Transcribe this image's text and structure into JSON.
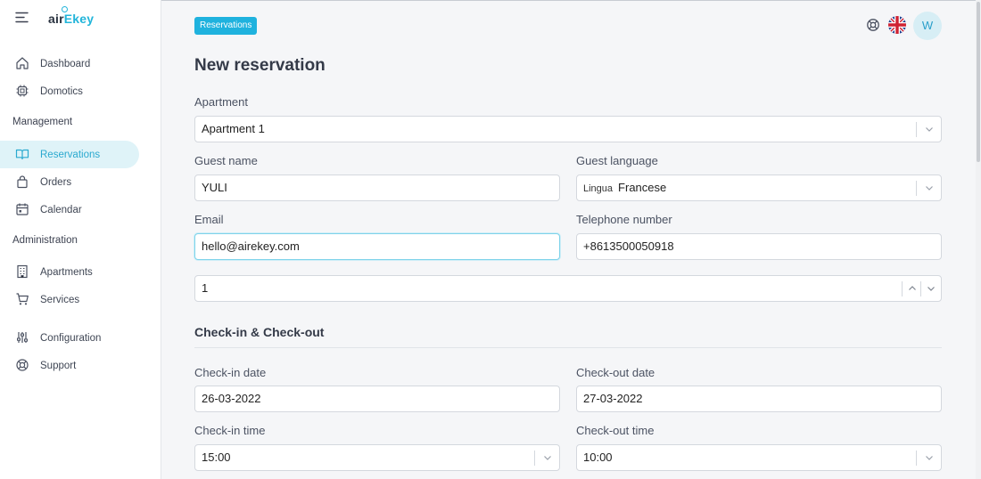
{
  "app": {
    "logo_prefix": "air",
    "logo_accent": "Ekey",
    "brand_color": "#22b5da"
  },
  "sidebar": {
    "items_top": [
      {
        "label": "Dashboard",
        "icon": "home-icon"
      },
      {
        "label": "Domotics",
        "icon": "chip-icon"
      }
    ],
    "management_title": "Management",
    "management_items": [
      {
        "label": "Reservations",
        "icon": "book-icon",
        "active": true
      },
      {
        "label": "Orders",
        "icon": "bag-icon"
      },
      {
        "label": "Calendar",
        "icon": "calendar-icon"
      }
    ],
    "administration_title": "Administration",
    "administration_items": [
      {
        "label": "Apartments",
        "icon": "building-icon"
      },
      {
        "label": "Services",
        "icon": "cart-icon"
      }
    ],
    "bottom_items": [
      {
        "label": "Configuration",
        "icon": "sliders-icon"
      },
      {
        "label": "Support",
        "icon": "lifebuoy-icon"
      }
    ]
  },
  "header": {
    "breadcrumb_badge": "Reservations",
    "avatar_initial": "W",
    "language_flag": "uk-flag-icon"
  },
  "form": {
    "title": "New reservation",
    "apartment": {
      "label": "Apartment",
      "value": "Apartment 1"
    },
    "guest_name": {
      "label": "Guest name",
      "value": "YULI"
    },
    "guest_language": {
      "label": "Guest language",
      "prefix": "Lingua",
      "value": "Francese"
    },
    "email": {
      "label": "Email",
      "value": "hello@airekey.com"
    },
    "telephone": {
      "label": "Telephone number",
      "value": "+8613500050918"
    },
    "guests_count": {
      "value": "1"
    },
    "checkin_section_title": "Check-in & Check-out",
    "checkin_date": {
      "label": "Check-in date",
      "value": "26-03-2022"
    },
    "checkout_date": {
      "label": "Check-out date",
      "value": "27-03-2022"
    },
    "checkin_time": {
      "label": "Check-in time",
      "value": "15:00"
    },
    "checkout_time": {
      "label": "Check-out time",
      "value": "10:00"
    }
  },
  "colors": {
    "accent": "#1fb2de",
    "active_bg": "#dff3f8"
  }
}
